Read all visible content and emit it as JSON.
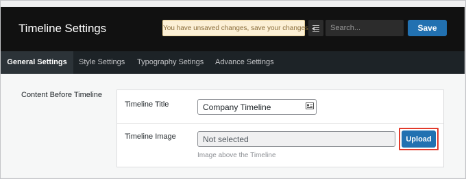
{
  "header": {
    "title": "Timeline Settings",
    "notice": "You have unsaved changes, save your changes!",
    "menu_icon": "list-collapse-icon",
    "search_placeholder": "Search...",
    "save_label": "Save"
  },
  "tabs": [
    {
      "label": "General Settings",
      "active": true
    },
    {
      "label": "Style Settings",
      "active": false
    },
    {
      "label": "Typography Setings",
      "active": false
    },
    {
      "label": "Advance Settings",
      "active": false
    }
  ],
  "section": {
    "label": "Content Before Timeline",
    "fields": {
      "timeline_title": {
        "label": "Timeline Title",
        "value": "Company Timeline",
        "icon": "id-card-icon"
      },
      "timeline_image": {
        "label": "Timeline Image",
        "value": "Not selected",
        "button": "Upload",
        "help": "Image above the Timeline"
      }
    }
  },
  "colors": {
    "header_bg": "#111111",
    "tabs_bg": "#1d2327",
    "primary_button": "#2271b1",
    "notice_bg": "#fcf0d6",
    "highlight_outline": "#e23a2b"
  }
}
